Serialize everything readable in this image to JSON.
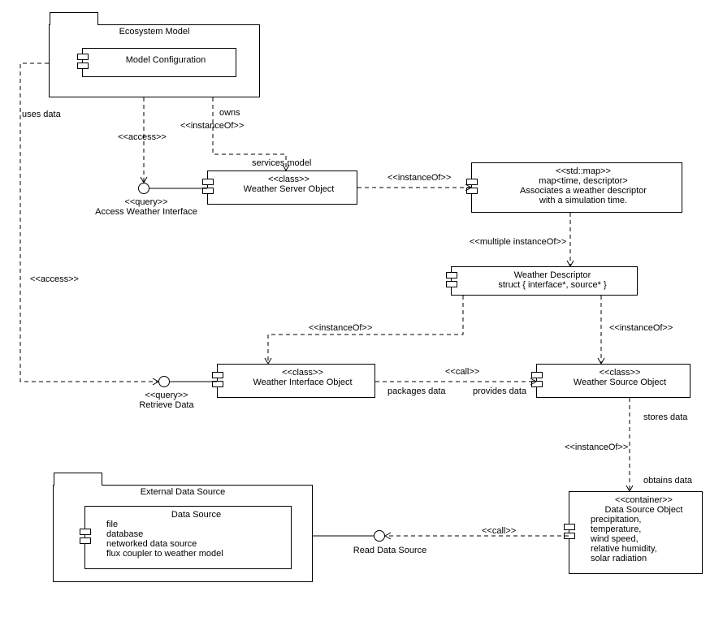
{
  "packages": {
    "ecosystem": {
      "title": "Ecosystem Model"
    },
    "external": {
      "title": "External Data Source"
    }
  },
  "components": {
    "modelConfig": {
      "title": "Model Configuration"
    },
    "weatherServer": {
      "stereo": "<<class>>",
      "title": "Weather Server Object"
    },
    "stdMap": {
      "stereo": "<<std::map>>",
      "line1": "map<time, descriptor>",
      "line2": "Associates a weather descriptor",
      "line3": "with a simulation time."
    },
    "weatherDescriptor": {
      "title": "Weather Descriptor",
      "sub": "struct { interface*, source* }"
    },
    "weatherInterface": {
      "stereo": "<<class>>",
      "title": "Weather Interface Object"
    },
    "weatherSource": {
      "stereo": "<<class>>",
      "title": "Weather Source Object"
    },
    "dataSourceObj": {
      "stereo": "<<container>>",
      "title": "Data Source Object",
      "l1": "precipitation,",
      "l2": "temperature,",
      "l3": "wind speed,",
      "l4": "relative humidity,",
      "l5": "solar radiation"
    },
    "dataSource": {
      "title": "Data Source",
      "l1": "file",
      "l2": "database",
      "l3": "networked data source",
      "l4": "flux coupler to weather model"
    }
  },
  "interfaces": {
    "accessWeather": {
      "stereo": "<<query>>",
      "name": "Access Weather Interface"
    },
    "retrieveData": {
      "stereo": "<<query>>",
      "name": "Retrieve Data"
    },
    "readDataSource": {
      "name": "Read Data Source"
    }
  },
  "edges": {
    "usesData": "uses data",
    "access1": "<<access>>",
    "owns": "owns",
    "instanceOf1": "<<instanceOf>>",
    "servicesModel": "services model",
    "instanceOf2": "<<instanceOf>>",
    "multipleInstanceOf": "<<multiple instanceOf>>",
    "instanceOf3": "<<instanceOf>>",
    "instanceOf4": "<<instanceOf>>",
    "access2": "<<access>>",
    "call1": "<<call>>",
    "packagesData": "packages data",
    "providesData": "provides data",
    "storesData": "stores data",
    "instanceOf5": "<<instanceOf>>",
    "obtainsData": "obtains data",
    "call2": "<<call>>"
  }
}
